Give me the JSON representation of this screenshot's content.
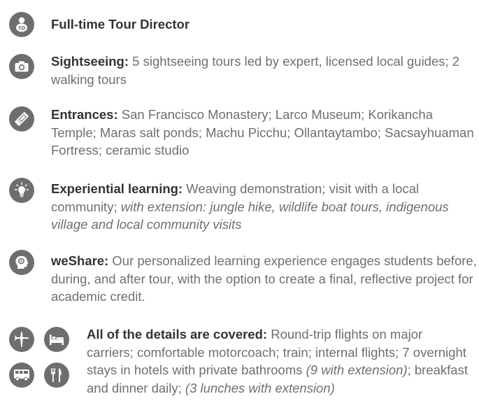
{
  "features": [
    {
      "id": "tour-director",
      "icon": "tour-director-icon",
      "title": "Full-time Tour Director",
      "segments": []
    },
    {
      "id": "sightseeing",
      "icon": "camera-icon",
      "title": "Sightseeing:",
      "segments": [
        {
          "text": " 5 sightseeing tours led by expert, licensed local guides; 2 walking tours",
          "italic": false
        }
      ]
    },
    {
      "id": "entrances",
      "icon": "ticket-icon",
      "title": "Entrances:",
      "segments": [
        {
          "text": " San Francisco Monastery; Larco Museum; Korikancha Temple; Maras salt ponds; Machu Picchu; Ollantaytambo; Sacsayhuaman Fortress; ceramic studio",
          "italic": false
        }
      ]
    },
    {
      "id": "experiential-learning",
      "icon": "lightbulb-icon",
      "title": "Experiential learning:",
      "segments": [
        {
          "text": " Weaving demonstration; visit with a local community; ",
          "italic": false
        },
        {
          "text": "with extension: jungle hike, wildlife boat tours, indigenous village and local community visits",
          "italic": true
        }
      ]
    },
    {
      "id": "weshare",
      "icon": "head-icon",
      "title": "weShare:",
      "segments": [
        {
          "text": " Our personalized learning experience engages students before, during, and after tour, with the option to create a final, reflective project for academic credit.",
          "italic": false
        }
      ]
    },
    {
      "id": "details",
      "icons": [
        "airplane-icon",
        "bed-icon",
        "bus-icon",
        "utensils-icon"
      ],
      "title": "All of the details are covered:",
      "segments": [
        {
          "text": " Round-trip flights on major carriers; comfortable motorcoach; train; internal flights; 7 overnight stays in hotels with private bathrooms ",
          "italic": false
        },
        {
          "text": "(9 with extension)",
          "italic": true
        },
        {
          "text": "; breakfast and dinner daily; ",
          "italic": false
        },
        {
          "text": "(3 lunches with extension)",
          "italic": true
        }
      ]
    }
  ],
  "colors": {
    "icon_bg": "#6e6e6e",
    "title": "#333333",
    "body": "#6f6f6f",
    "icon_fg": "#ffffff"
  }
}
